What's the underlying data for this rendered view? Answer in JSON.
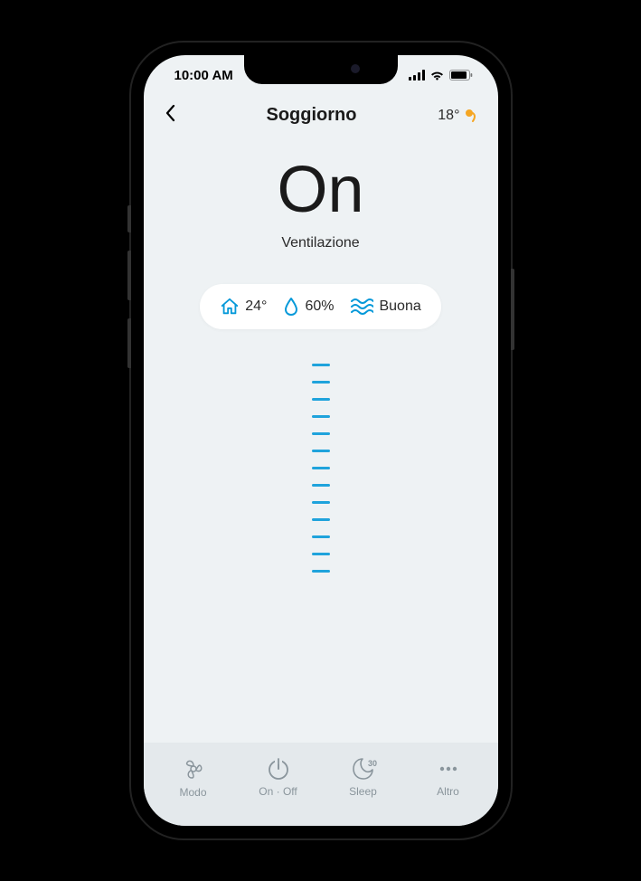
{
  "status_bar": {
    "time": "10:00 AM"
  },
  "header": {
    "title": "Soggiorno",
    "outside_temp": "18°"
  },
  "main": {
    "state": "On",
    "mode": "Ventilazione"
  },
  "info": {
    "indoor_temp": "24°",
    "humidity": "60%",
    "air_quality": "Buona"
  },
  "scale": {
    "ticks": 13
  },
  "bottom": {
    "modo": "Modo",
    "onoff": "On · Off",
    "sleep": "Sleep",
    "sleep_badge": "30",
    "altro": "Altro"
  }
}
